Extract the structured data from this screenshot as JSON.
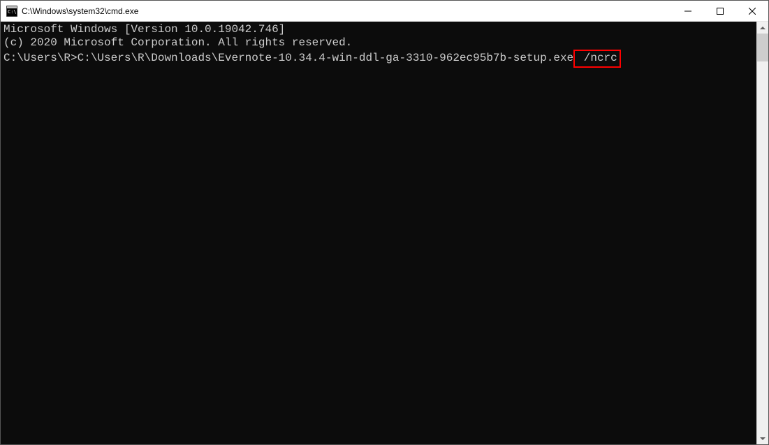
{
  "window": {
    "title": "C:\\Windows\\system32\\cmd.exe"
  },
  "terminal": {
    "line1": "Microsoft Windows [Version 10.0.19042.746]",
    "line2": "(c) 2020 Microsoft Corporation. All rights reserved.",
    "blank": "",
    "prompt_prefix": "C:\\Users\\R>",
    "command_path": "C:\\Users\\R\\Downloads\\Evernote-10.34.4-win-ddl-ga-3310-962ec95b7b-setup.exe",
    "command_flag": " /ncrc"
  }
}
